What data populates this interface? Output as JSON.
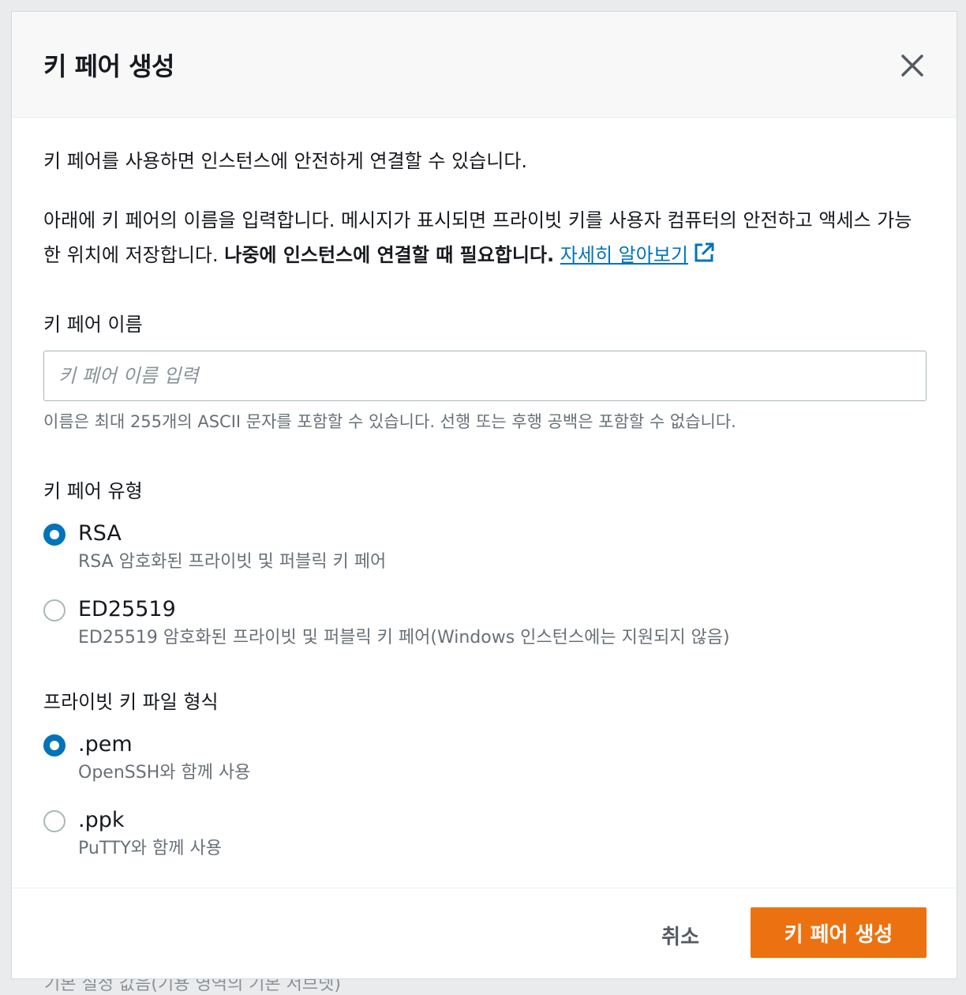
{
  "backdrop": {
    "partial_text": "기본 설정 값음(기용 영역의 기본 서브넷)"
  },
  "modal": {
    "title": "키 페어 생성",
    "intro": "키 페어를 사용하면 인스턴스에 안전하게 연결할 수 있습니다.",
    "instruction": "아래에 키 페어의 이름을 입력합니다. 메시지가 표시되면 프라이빗 키를 사용자 컴퓨터의 안전하고 액세스 가능한 위치에 저장합니다. ",
    "instruction_bold": "나중에 인스턴스에 연결할 때 필요합니다.",
    "learn_more": "자세히 알아보기",
    "name_field": {
      "label": "키 페어 이름",
      "placeholder": "키 페어 이름 입력",
      "value": "",
      "hint": "이름은 최대 255개의 ASCII 문자를 포함할 수 있습니다. 선행 또는 후행 공백은 포함할 수 없습니다."
    },
    "key_type": {
      "label": "키 페어 유형",
      "options": [
        {
          "title": "RSA",
          "desc": "RSA 암호화된 프라이빗 및 퍼블릭 키 페어",
          "selected": true
        },
        {
          "title": "ED25519",
          "desc": "ED25519 암호화된 프라이빗 및 퍼블릭 키 페어(Windows 인스턴스에는 지원되지 않음)",
          "selected": false
        }
      ]
    },
    "file_format": {
      "label": "프라이빗 키 파일 형식",
      "options": [
        {
          "title": ".pem",
          "desc": "OpenSSH와 함께 사용",
          "selected": true
        },
        {
          "title": ".ppk",
          "desc": "PuTTY와 함께 사용",
          "selected": false
        }
      ]
    },
    "footer": {
      "cancel_label": "취소",
      "create_label": "키 페어 생성"
    }
  },
  "colors": {
    "accent": "#0073bb",
    "primary_button": "#ec7211",
    "header_bg": "#f8f8f8"
  },
  "icons": {
    "close": "close-icon",
    "external_link": "external-link-icon"
  }
}
